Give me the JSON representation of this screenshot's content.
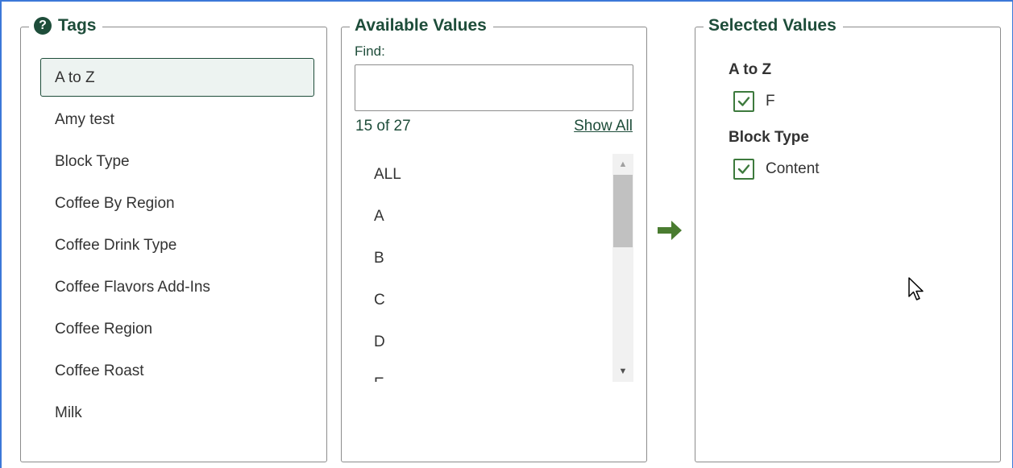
{
  "tags_panel": {
    "title": "Tags",
    "items": [
      {
        "label": "A to Z",
        "selected": true
      },
      {
        "label": "Amy test"
      },
      {
        "label": "Block Type"
      },
      {
        "label": "Coffee By Region"
      },
      {
        "label": "Coffee Drink Type"
      },
      {
        "label": "Coffee Flavors Add-Ins"
      },
      {
        "label": "Coffee Region"
      },
      {
        "label": "Coffee Roast"
      },
      {
        "label": "Milk"
      }
    ]
  },
  "available_panel": {
    "title": "Available Values",
    "find_label": "Find:",
    "find_value": "",
    "count": "15 of 27",
    "show_all": "Show All",
    "values": [
      "ALL",
      "A",
      "B",
      "C",
      "D",
      "E"
    ]
  },
  "selected_panel": {
    "title": "Selected Values",
    "groups": [
      {
        "title": "A to Z",
        "options": [
          {
            "label": "F",
            "checked": true
          }
        ]
      },
      {
        "title": "Block Type",
        "options": [
          {
            "label": "Content",
            "checked": true
          }
        ]
      }
    ]
  },
  "colors": {
    "brand_green": "#1e4d3a",
    "check_green": "#3d7a3d",
    "arrow_green": "#4a7c30",
    "frame_blue": "#3c78d8"
  },
  "icons": {
    "help": "question-circle-icon",
    "move": "arrow-right-icon",
    "check": "checkmark-icon"
  }
}
